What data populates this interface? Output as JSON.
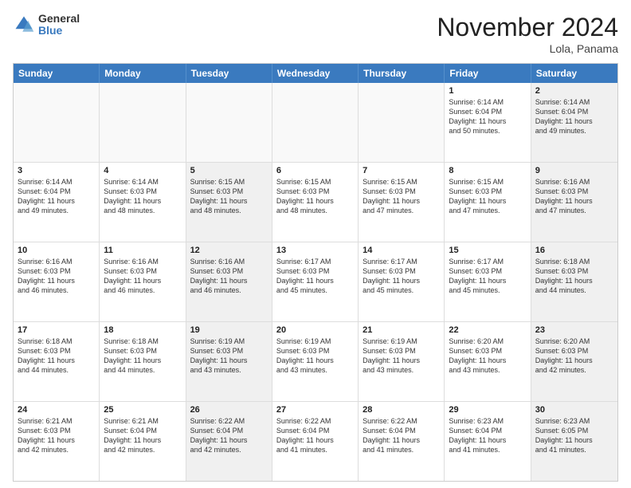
{
  "logo": {
    "general": "General",
    "blue": "Blue"
  },
  "header": {
    "month": "November 2024",
    "location": "Lola, Panama"
  },
  "days": [
    "Sunday",
    "Monday",
    "Tuesday",
    "Wednesday",
    "Thursday",
    "Friday",
    "Saturday"
  ],
  "weeks": [
    [
      {
        "day": "",
        "text": "",
        "shaded": false,
        "empty": true
      },
      {
        "day": "",
        "text": "",
        "shaded": false,
        "empty": true
      },
      {
        "day": "",
        "text": "",
        "shaded": false,
        "empty": true
      },
      {
        "day": "",
        "text": "",
        "shaded": false,
        "empty": true
      },
      {
        "day": "",
        "text": "",
        "shaded": false,
        "empty": true
      },
      {
        "day": "1",
        "text": "Sunrise: 6:14 AM\nSunset: 6:04 PM\nDaylight: 11 hours\nand 50 minutes.",
        "shaded": false,
        "empty": false
      },
      {
        "day": "2",
        "text": "Sunrise: 6:14 AM\nSunset: 6:04 PM\nDaylight: 11 hours\nand 49 minutes.",
        "shaded": true,
        "empty": false
      }
    ],
    [
      {
        "day": "3",
        "text": "Sunrise: 6:14 AM\nSunset: 6:04 PM\nDaylight: 11 hours\nand 49 minutes.",
        "shaded": false,
        "empty": false
      },
      {
        "day": "4",
        "text": "Sunrise: 6:14 AM\nSunset: 6:03 PM\nDaylight: 11 hours\nand 48 minutes.",
        "shaded": false,
        "empty": false
      },
      {
        "day": "5",
        "text": "Sunrise: 6:15 AM\nSunset: 6:03 PM\nDaylight: 11 hours\nand 48 minutes.",
        "shaded": true,
        "empty": false
      },
      {
        "day": "6",
        "text": "Sunrise: 6:15 AM\nSunset: 6:03 PM\nDaylight: 11 hours\nand 48 minutes.",
        "shaded": false,
        "empty": false
      },
      {
        "day": "7",
        "text": "Sunrise: 6:15 AM\nSunset: 6:03 PM\nDaylight: 11 hours\nand 47 minutes.",
        "shaded": false,
        "empty": false
      },
      {
        "day": "8",
        "text": "Sunrise: 6:15 AM\nSunset: 6:03 PM\nDaylight: 11 hours\nand 47 minutes.",
        "shaded": false,
        "empty": false
      },
      {
        "day": "9",
        "text": "Sunrise: 6:16 AM\nSunset: 6:03 PM\nDaylight: 11 hours\nand 47 minutes.",
        "shaded": true,
        "empty": false
      }
    ],
    [
      {
        "day": "10",
        "text": "Sunrise: 6:16 AM\nSunset: 6:03 PM\nDaylight: 11 hours\nand 46 minutes.",
        "shaded": false,
        "empty": false
      },
      {
        "day": "11",
        "text": "Sunrise: 6:16 AM\nSunset: 6:03 PM\nDaylight: 11 hours\nand 46 minutes.",
        "shaded": false,
        "empty": false
      },
      {
        "day": "12",
        "text": "Sunrise: 6:16 AM\nSunset: 6:03 PM\nDaylight: 11 hours\nand 46 minutes.",
        "shaded": true,
        "empty": false
      },
      {
        "day": "13",
        "text": "Sunrise: 6:17 AM\nSunset: 6:03 PM\nDaylight: 11 hours\nand 45 minutes.",
        "shaded": false,
        "empty": false
      },
      {
        "day": "14",
        "text": "Sunrise: 6:17 AM\nSunset: 6:03 PM\nDaylight: 11 hours\nand 45 minutes.",
        "shaded": false,
        "empty": false
      },
      {
        "day": "15",
        "text": "Sunrise: 6:17 AM\nSunset: 6:03 PM\nDaylight: 11 hours\nand 45 minutes.",
        "shaded": false,
        "empty": false
      },
      {
        "day": "16",
        "text": "Sunrise: 6:18 AM\nSunset: 6:03 PM\nDaylight: 11 hours\nand 44 minutes.",
        "shaded": true,
        "empty": false
      }
    ],
    [
      {
        "day": "17",
        "text": "Sunrise: 6:18 AM\nSunset: 6:03 PM\nDaylight: 11 hours\nand 44 minutes.",
        "shaded": false,
        "empty": false
      },
      {
        "day": "18",
        "text": "Sunrise: 6:18 AM\nSunset: 6:03 PM\nDaylight: 11 hours\nand 44 minutes.",
        "shaded": false,
        "empty": false
      },
      {
        "day": "19",
        "text": "Sunrise: 6:19 AM\nSunset: 6:03 PM\nDaylight: 11 hours\nand 43 minutes.",
        "shaded": true,
        "empty": false
      },
      {
        "day": "20",
        "text": "Sunrise: 6:19 AM\nSunset: 6:03 PM\nDaylight: 11 hours\nand 43 minutes.",
        "shaded": false,
        "empty": false
      },
      {
        "day": "21",
        "text": "Sunrise: 6:19 AM\nSunset: 6:03 PM\nDaylight: 11 hours\nand 43 minutes.",
        "shaded": false,
        "empty": false
      },
      {
        "day": "22",
        "text": "Sunrise: 6:20 AM\nSunset: 6:03 PM\nDaylight: 11 hours\nand 43 minutes.",
        "shaded": false,
        "empty": false
      },
      {
        "day": "23",
        "text": "Sunrise: 6:20 AM\nSunset: 6:03 PM\nDaylight: 11 hours\nand 42 minutes.",
        "shaded": true,
        "empty": false
      }
    ],
    [
      {
        "day": "24",
        "text": "Sunrise: 6:21 AM\nSunset: 6:03 PM\nDaylight: 11 hours\nand 42 minutes.",
        "shaded": false,
        "empty": false
      },
      {
        "day": "25",
        "text": "Sunrise: 6:21 AM\nSunset: 6:04 PM\nDaylight: 11 hours\nand 42 minutes.",
        "shaded": false,
        "empty": false
      },
      {
        "day": "26",
        "text": "Sunrise: 6:22 AM\nSunset: 6:04 PM\nDaylight: 11 hours\nand 42 minutes.",
        "shaded": true,
        "empty": false
      },
      {
        "day": "27",
        "text": "Sunrise: 6:22 AM\nSunset: 6:04 PM\nDaylight: 11 hours\nand 41 minutes.",
        "shaded": false,
        "empty": false
      },
      {
        "day": "28",
        "text": "Sunrise: 6:22 AM\nSunset: 6:04 PM\nDaylight: 11 hours\nand 41 minutes.",
        "shaded": false,
        "empty": false
      },
      {
        "day": "29",
        "text": "Sunrise: 6:23 AM\nSunset: 6:04 PM\nDaylight: 11 hours\nand 41 minutes.",
        "shaded": false,
        "empty": false
      },
      {
        "day": "30",
        "text": "Sunrise: 6:23 AM\nSunset: 6:05 PM\nDaylight: 11 hours\nand 41 minutes.",
        "shaded": true,
        "empty": false
      }
    ]
  ]
}
